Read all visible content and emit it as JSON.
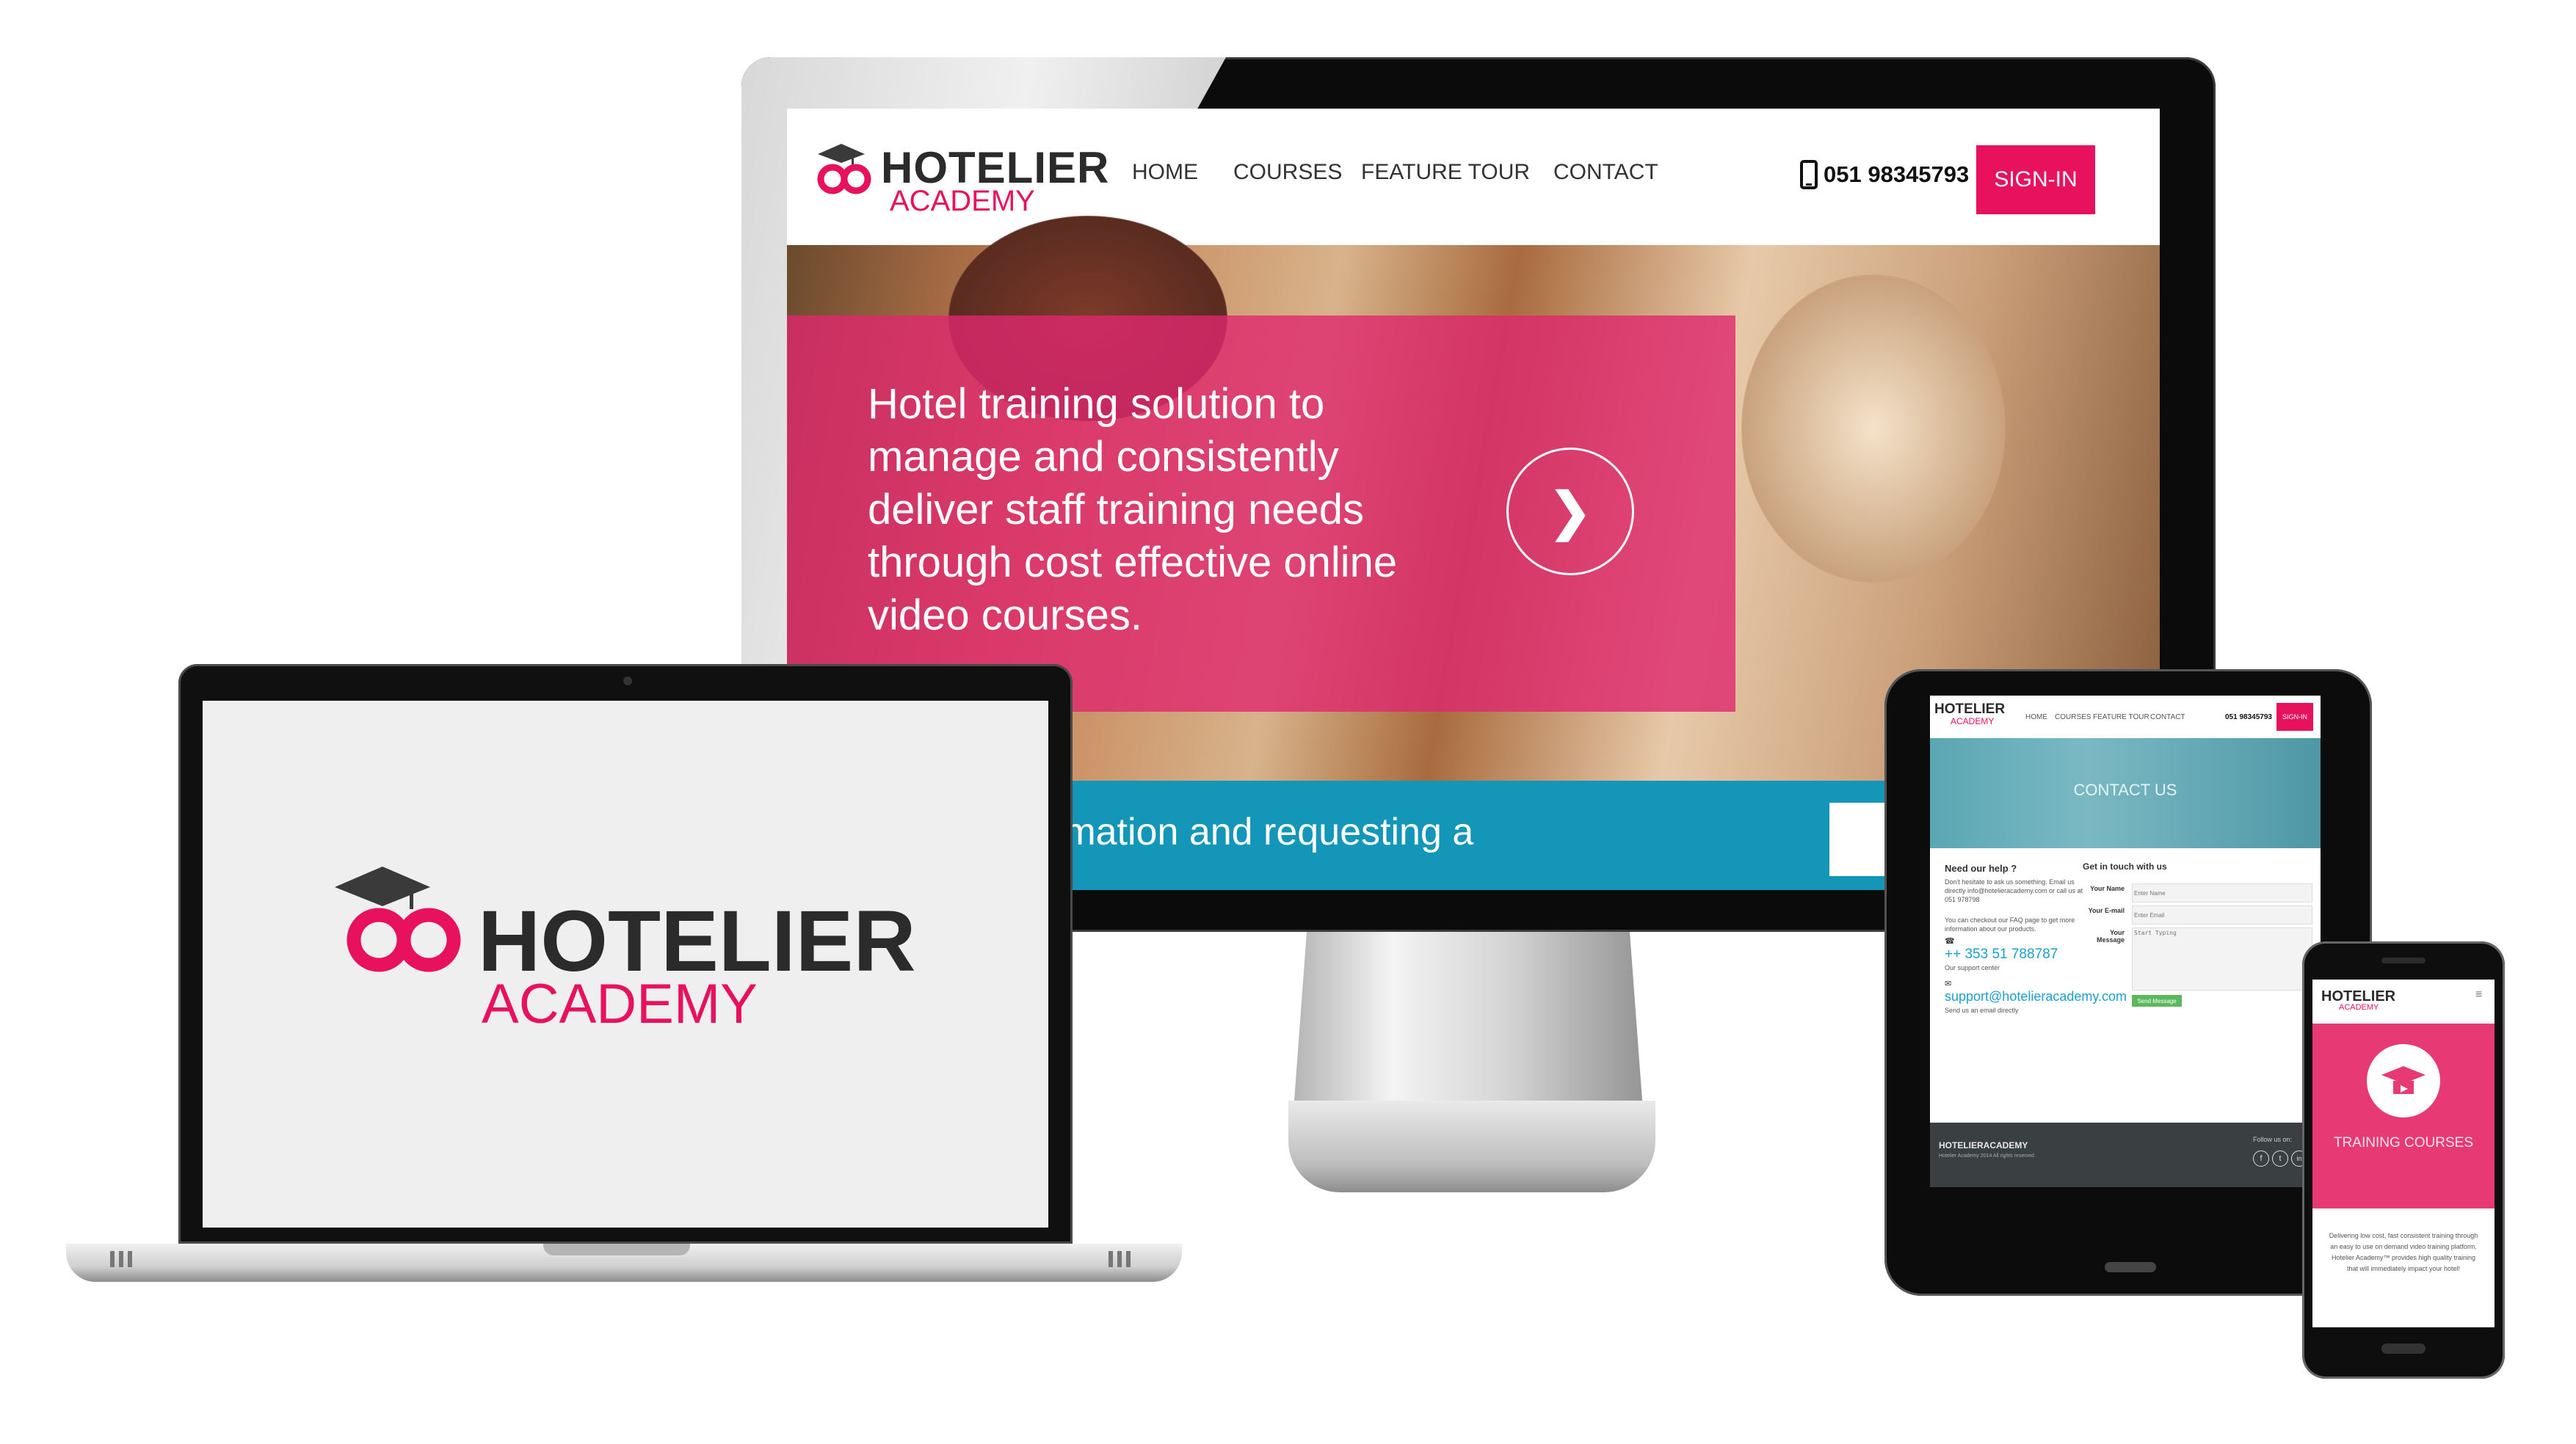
{
  "brand": {
    "name": "HOTELIER",
    "sub": "ACADEMY",
    "pink": "#e8115e",
    "dark": "#2b2b2b"
  },
  "monitor": {
    "nav": [
      "HOME",
      "COURSES",
      "FEATURE TOUR",
      "CONTACT"
    ],
    "phone": "051 98345793",
    "signin": "SIGN-IN",
    "hero_text": "Hotel training solution to manage and consistently deliver staff training needs through cost effective online video courses.",
    "arrow": "❯",
    "strip_text": "rmation and requesting a"
  },
  "laptop": {
    "logo_name": "HOTELIER",
    "logo_sub": "ACADEMY"
  },
  "tablet": {
    "nav": [
      "HOME",
      "COURSES",
      "FEATURE TOUR",
      "CONTACT"
    ],
    "phone": "051 98345793",
    "signin": "SIGN-IN",
    "banner_title": "CONTACT US",
    "help_title": "Need our help ?",
    "help_text": "Don't hesitate to ask us something. Email us directly info@hotelieracademy.com or call us at 051 978798",
    "faq_text": "You can checkout our FAQ page to get more information about our products.",
    "support_phone": "++ 353 51 788787",
    "support_phone_caption": "Our support center",
    "support_email": "support@hotelieracademy.com",
    "support_email_caption": "Send us an email directly",
    "form_title": "Get in touch with us",
    "label_name": "Your Name",
    "label_email": "Your E-mail",
    "label_message": "Your Message",
    "ph_name": "Enter Name",
    "ph_email": "Enter Email",
    "ph_message": "Start Typing",
    "send_button": "Send Message",
    "footer_logo": "HOTELIERACADEMY",
    "footer_copy": "Hotelier Academy 2014 All rights reserved",
    "follow": "Follow us on:",
    "social": [
      "f",
      "t",
      "in"
    ]
  },
  "phone": {
    "logo_name": "HOTELIER",
    "logo_sub": "ACADEMY",
    "menu_icon": "≡",
    "title": "TRAINING COURSES",
    "body": "Delivering low cost, fast consistent training through an easy to use on demand video training platform. Hotelier Academy™ provides high quality training that will immediately impact your hotel!"
  }
}
